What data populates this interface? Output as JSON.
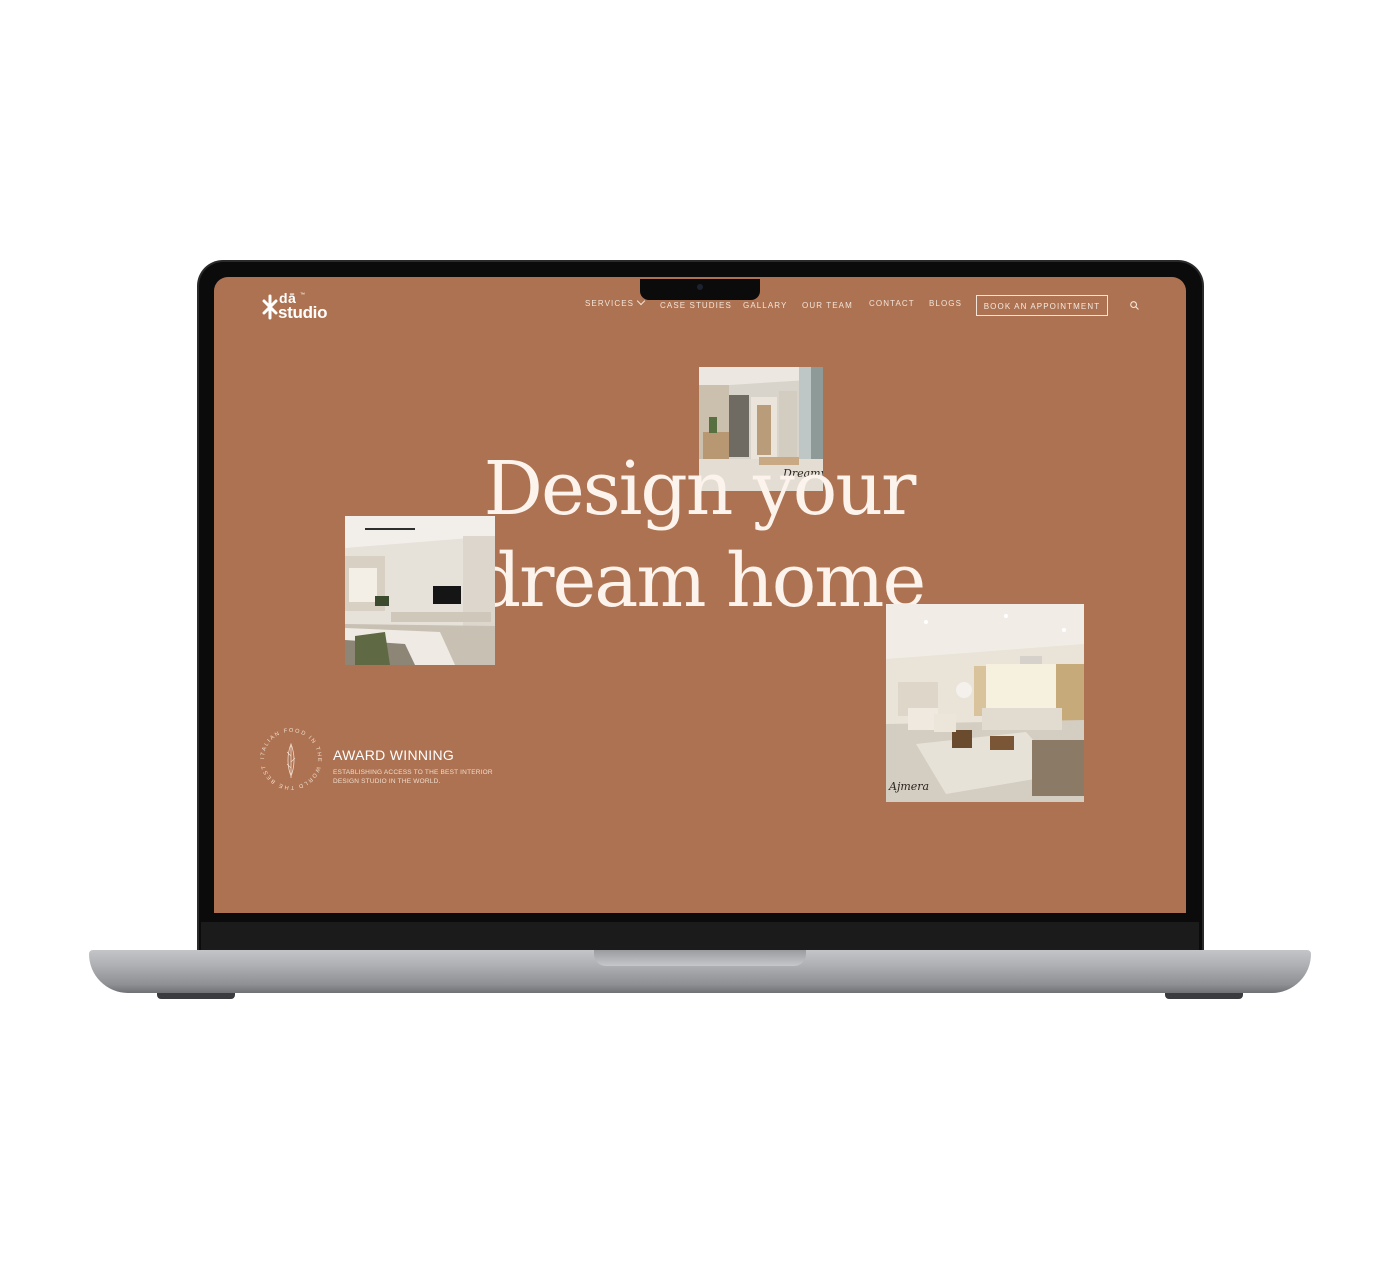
{
  "brand": {
    "name_top": "dā",
    "name_bottom": "studio",
    "trademark": "™"
  },
  "nav": {
    "items": [
      {
        "label": "SERVICES"
      },
      {
        "label": "CASE STUDIES"
      },
      {
        "label": "GALLARY"
      },
      {
        "label": "OUR TEAM"
      },
      {
        "label": "CONTACT"
      },
      {
        "label": "BLOGS"
      }
    ],
    "cta_label": "BOOK AN APPOINTMENT"
  },
  "hero": {
    "line1": "Design your",
    "line2": "dream home"
  },
  "award": {
    "title": "AWARD WINNING",
    "description": "ESTABLISHING ACCESS TO THE BEST INTERIOR DESIGN STUDIO IN THE WORLD.",
    "seal_text": "ITALIAN FOOD IN THE WORLD THE BEST"
  },
  "photos": {
    "hallway_caption": "Dreamy",
    "living_caption": "Ajmera"
  },
  "colors": {
    "background": "#ad7251",
    "text": "#ffffff"
  }
}
